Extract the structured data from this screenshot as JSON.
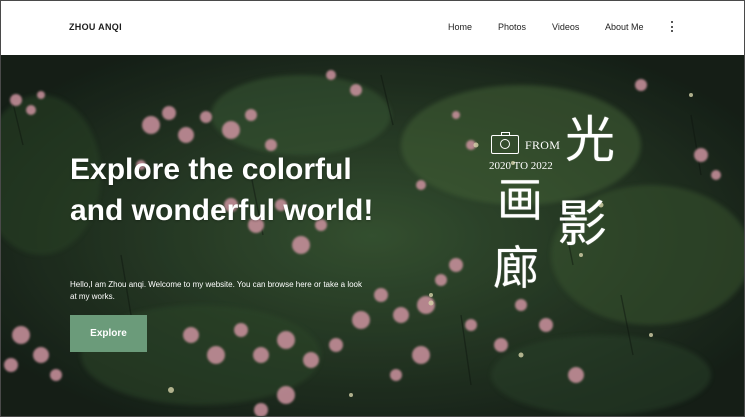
{
  "header": {
    "brand": "ZHOU ANQI",
    "nav": [
      "Home",
      "Photos",
      "Videos",
      "About Me"
    ],
    "more_icon": "vertical-ellipsis-icon"
  },
  "hero": {
    "headline": "Explore the colorful and wonderful world!",
    "intro": "Hello,I am Zhou anqi. Welcome to my website. You can browse here or take a look at my works.",
    "button_label": "Explore",
    "button_color": "#6b9b7a"
  },
  "logo": {
    "icon": "camera-icon",
    "from": "FROM",
    "years": "2020 TO 2022",
    "chars": [
      "光",
      "画",
      "影",
      "廊"
    ]
  },
  "colors": {
    "header_bg": "#ffffff",
    "foliage": "#1f2b20",
    "flower_pink": "#e9a7b6"
  }
}
